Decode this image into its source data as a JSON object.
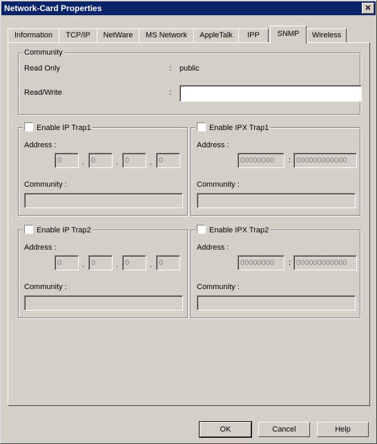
{
  "window": {
    "title": "Network-Card Properties",
    "close_glyph": "✕"
  },
  "tabs": [
    {
      "label": "Information"
    },
    {
      "label": "TCP/IP"
    },
    {
      "label": "NetWare"
    },
    {
      "label": "MS Network"
    },
    {
      "label": "AppleTalk"
    },
    {
      "label": "IPP"
    },
    {
      "label": "SNMP",
      "active": true
    },
    {
      "label": "Wireless"
    }
  ],
  "community": {
    "legend": "Community",
    "read_only_label": "Read Only",
    "read_only_sep": ":",
    "read_only_value": "public",
    "read_write_label": "Read/Write",
    "read_write_sep": ":",
    "read_write_value": ""
  },
  "ip_trap1": {
    "legend": "Enable IP Trap1",
    "checked": false,
    "address_label": "Address :",
    "octets": [
      "0",
      "0",
      "0",
      "0"
    ],
    "dot": ".",
    "community_label": "Community :",
    "community_value": ""
  },
  "ipx_trap1": {
    "legend": "Enable IPX Trap1",
    "checked": false,
    "address_label": "Address :",
    "network": "00000000",
    "sep": ":",
    "node": "000000000000",
    "community_label": "Community :",
    "community_value": ""
  },
  "ip_trap2": {
    "legend": "Enable IP Trap2",
    "checked": false,
    "address_label": "Address :",
    "octets": [
      "0",
      "0",
      "0",
      "0"
    ],
    "dot": ".",
    "community_label": "Community :",
    "community_value": ""
  },
  "ipx_trap2": {
    "legend": "Enable IPX Trap2",
    "checked": false,
    "address_label": "Address :",
    "network": "00000000",
    "sep": ":",
    "node": "000000000000",
    "community_label": "Community :",
    "community_value": ""
  },
  "buttons": {
    "ok": "OK",
    "cancel": "Cancel",
    "help": "Help"
  }
}
